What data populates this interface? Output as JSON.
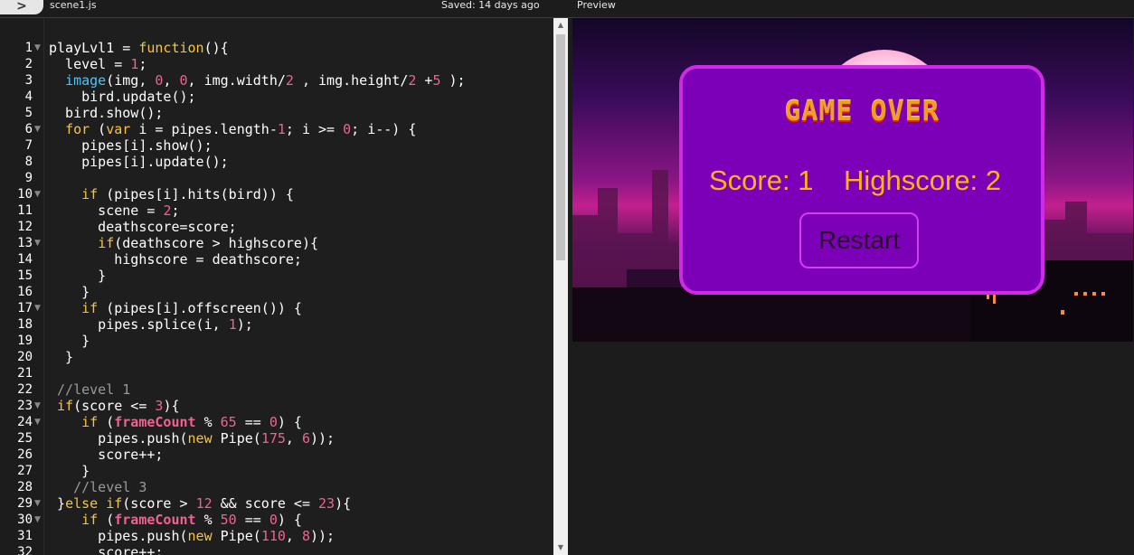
{
  "topbar": {
    "toggle_label": ">",
    "file_name": "scene1.js",
    "saved_status": "Saved: 14 days ago",
    "preview_label": "Preview"
  },
  "editor": {
    "lines": [
      {
        "n": "1",
        "fold": true,
        "text": "playLvl1 = function(){"
      },
      {
        "n": "2",
        "fold": false,
        "text": "  level = 1;"
      },
      {
        "n": "3",
        "fold": false,
        "text": "  image(img, 0, 0, img.width/2 , img.height/2 +5 );"
      },
      {
        "n": "4",
        "fold": false,
        "text": "    bird.update();"
      },
      {
        "n": "5",
        "fold": false,
        "text": "  bird.show();"
      },
      {
        "n": "6",
        "fold": true,
        "text": "  for (var i = pipes.length-1; i >= 0; i--) {"
      },
      {
        "n": "7",
        "fold": false,
        "text": "    pipes[i].show();"
      },
      {
        "n": "8",
        "fold": false,
        "text": "    pipes[i].update();"
      },
      {
        "n": "9",
        "fold": false,
        "text": ""
      },
      {
        "n": "10",
        "fold": true,
        "text": "    if (pipes[i].hits(bird)) {"
      },
      {
        "n": "11",
        "fold": false,
        "text": "      scene = 2;"
      },
      {
        "n": "12",
        "fold": false,
        "text": "      deathscore=score;"
      },
      {
        "n": "13",
        "fold": true,
        "text": "      if(deathscore > highscore){"
      },
      {
        "n": "14",
        "fold": false,
        "text": "        highscore = deathscore;"
      },
      {
        "n": "15",
        "fold": false,
        "text": "      }"
      },
      {
        "n": "16",
        "fold": false,
        "text": "    }"
      },
      {
        "n": "17",
        "fold": true,
        "text": "    if (pipes[i].offscreen()) {"
      },
      {
        "n": "18",
        "fold": false,
        "text": "      pipes.splice(i, 1);"
      },
      {
        "n": "19",
        "fold": false,
        "text": "    }"
      },
      {
        "n": "20",
        "fold": false,
        "text": "  }"
      },
      {
        "n": "21",
        "fold": false,
        "text": ""
      },
      {
        "n": "22",
        "fold": false,
        "text": " //level 1"
      },
      {
        "n": "23",
        "fold": true,
        "text": " if(score <= 3){"
      },
      {
        "n": "24",
        "fold": true,
        "text": "    if (frameCount % 65 == 0) {"
      },
      {
        "n": "25",
        "fold": false,
        "text": "      pipes.push(new Pipe(175, 6));"
      },
      {
        "n": "26",
        "fold": false,
        "text": "      score++;"
      },
      {
        "n": "27",
        "fold": false,
        "text": "    }"
      },
      {
        "n": "28",
        "fold": false,
        "text": "   //level 3"
      },
      {
        "n": "29",
        "fold": true,
        "text": " }else if(score > 12 && score <= 23){"
      },
      {
        "n": "30",
        "fold": true,
        "text": "    if (frameCount % 50 == 0) {"
      },
      {
        "n": "31",
        "fold": false,
        "text": "      pipes.push(new Pipe(110, 8));"
      },
      {
        "n": "32",
        "fold": false,
        "text": "      score++;"
      }
    ]
  },
  "preview": {
    "game_over": "GAME OVER",
    "score_text": "Score: 1",
    "highscore_text": "Highscore: 2",
    "restart_label": "Restart"
  },
  "colors": {
    "editor_bg": "#1e1e1e",
    "dialog_bg": "#7c00b8",
    "dialog_border": "#cf2ae6",
    "score_color": "#ffb01a"
  }
}
